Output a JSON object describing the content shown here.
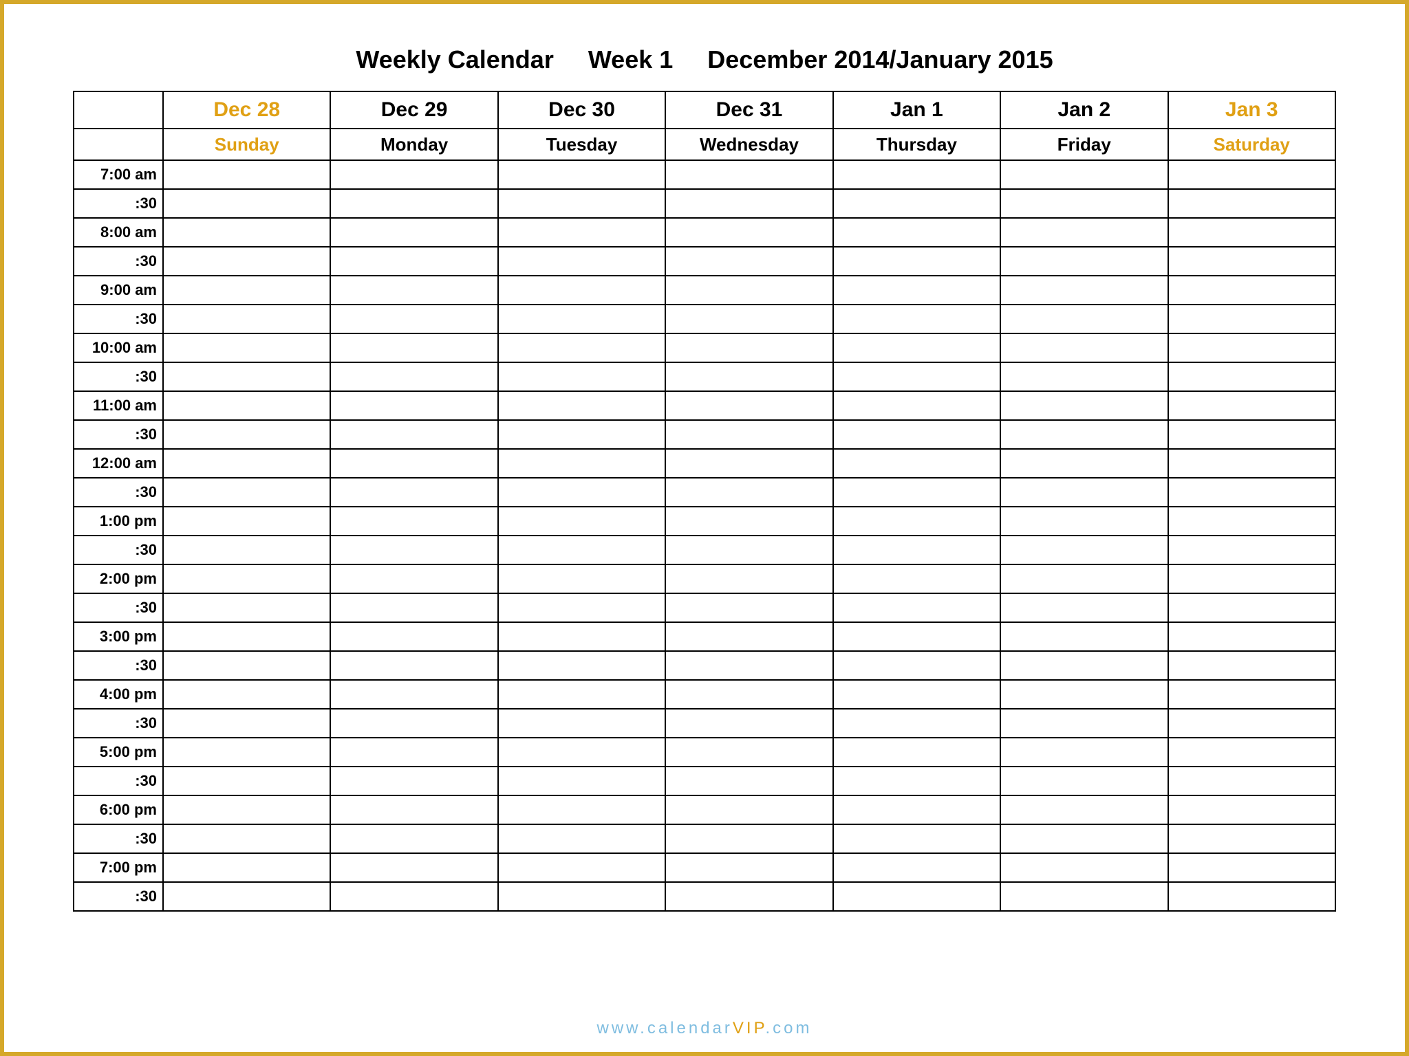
{
  "title": "Weekly Calendar     Week 1     December 2014/January 2015",
  "days": [
    {
      "date": "Dec 28",
      "name": "Sunday",
      "weekend": true
    },
    {
      "date": "Dec 29",
      "name": "Monday",
      "weekend": false
    },
    {
      "date": "Dec 30",
      "name": "Tuesday",
      "weekend": false
    },
    {
      "date": "Dec 31",
      "name": "Wednesday",
      "weekend": false
    },
    {
      "date": "Jan 1",
      "name": "Thursday",
      "weekend": false
    },
    {
      "date": "Jan 2",
      "name": "Friday",
      "weekend": false
    },
    {
      "date": "Jan 3",
      "name": "Saturday",
      "weekend": true
    }
  ],
  "times": [
    "7:00 am",
    ":30",
    "8:00 am",
    ":30",
    "9:00 am",
    ":30",
    "10:00 am",
    ":30",
    "11:00 am",
    ":30",
    "12:00 am",
    ":30",
    "1:00 pm",
    ":30",
    "2:00 pm",
    ":30",
    "3:00 pm",
    ":30",
    "4:00 pm",
    ":30",
    "5:00 pm",
    ":30",
    "6:00 pm",
    ":30",
    "7:00 pm",
    ":30"
  ],
  "footer": {
    "prefix": "www.calendar",
    "accent": "VIP",
    "suffix": ".com"
  }
}
